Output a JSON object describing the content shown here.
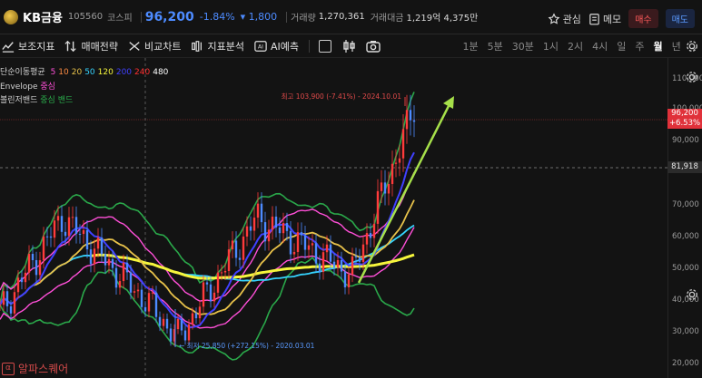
{
  "header": {
    "name": "KB금융",
    "code": "105560",
    "market": "코스피",
    "price": "96,200",
    "change_pct": "-1.84%",
    "change": "▾ 1,800",
    "volume_label": "거래량",
    "volume": "1,270,361",
    "amount_label": "거래대금",
    "amount": "1,219억 4,375만",
    "watch_label": "관심",
    "memo_label": "메모",
    "buy_label": "매수",
    "sell_label": "매도"
  },
  "toolbar": {
    "indicators": "보조지표",
    "strategy": "매매전략",
    "compare": "비교차트",
    "analysis": "지표분석",
    "ai": "AI예측",
    "periods": [
      "1분",
      "5분",
      "30분",
      "1시",
      "2시",
      "4시",
      "일",
      "주",
      "월",
      "년"
    ],
    "active_period": "월"
  },
  "legend": {
    "ma_label": "단순이동평균",
    "ma_periods": [
      {
        "v": "5",
        "color": "#ff4fd8"
      },
      {
        "v": "10",
        "color": "#ff8c42"
      },
      {
        "v": "20",
        "color": "#e8c24a"
      },
      {
        "v": "50",
        "color": "#35d4ff"
      },
      {
        "v": "120",
        "color": "#f6f63c"
      },
      {
        "v": "200",
        "color": "#4040ff"
      },
      {
        "v": "240",
        "color": "#ff3030"
      },
      {
        "v": "480",
        "color": "#ffffff"
      }
    ],
    "envelope_label": "Envelope",
    "envelope_mid": "중심",
    "bollinger_label": "볼린저밴드",
    "bollinger_mid": "중심",
    "bollinger_band": "밴드"
  },
  "annotations": {
    "high": "최고 103,900 (-7.41%) - 2024.10.01",
    "low": "최저 25,850 (+272.15%) - 2020.03.01"
  },
  "axis": {
    "ticks": [
      "110,000",
      "100,000",
      "90,000",
      "70,000",
      "60,000",
      "50,000",
      "40,000",
      "30,000",
      "20,000"
    ],
    "current_price": "96,200",
    "current_pct": "+6.53%",
    "crosshair": "81,918"
  },
  "watermark": "알파스퀘어",
  "colors": {
    "up": "#ff3b3b",
    "down": "#4d8bff",
    "bollinger": "#2aa84a",
    "envelope": "#ff4fd8",
    "ma50": "#35d4ff",
    "ma120": "#f6f63c",
    "ma20": "#e8c24a",
    "ma200": "#4040ff",
    "arrow": "#a6e04a"
  }
}
